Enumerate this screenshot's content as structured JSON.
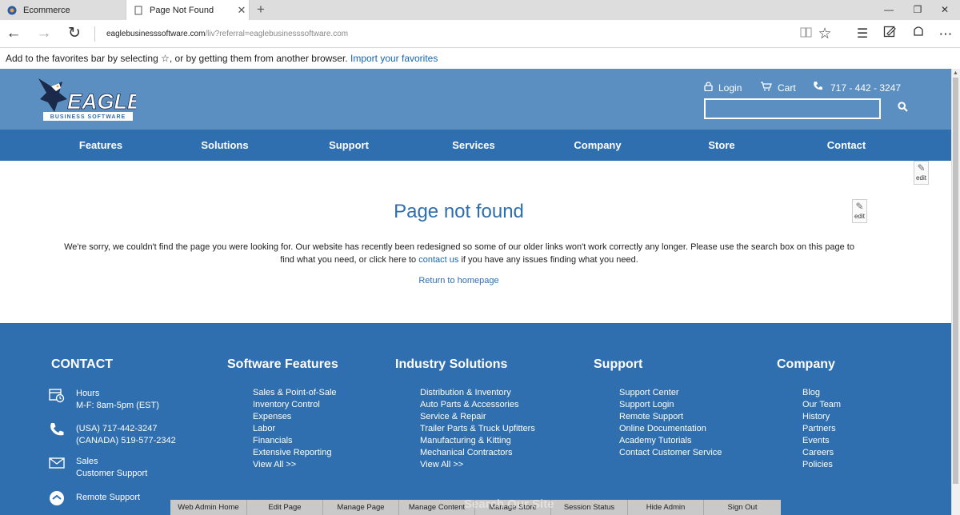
{
  "browser": {
    "tabs": [
      {
        "title": "Ecommerce",
        "active": false
      },
      {
        "title": "Page Not Found",
        "active": true
      }
    ],
    "url": {
      "host": "eaglebusinesssoftware.com",
      "path": "/liv?referral=eaglebusinesssoftware.com"
    },
    "favorites_hint": {
      "text": "Add to the favorites bar by selecting ☆, or by getting them from another browser.",
      "link": "Import your favorites"
    }
  },
  "site": {
    "logo": {
      "word": "EAGLE",
      "tagline": "BUSINESS SOFTWARE"
    },
    "top_links": {
      "login": "Login",
      "cart": "Cart",
      "phone": "717 - 442 - 3247"
    },
    "search": {
      "placeholder": ""
    },
    "nav": [
      "Features",
      "Solutions",
      "Support",
      "Services",
      "Company",
      "Store",
      "Contact"
    ],
    "edit_label": "edit",
    "content": {
      "title": "Page not found",
      "message_before": "We're sorry, we couldn't find the page you were looking for. Our website has recently been redesigned so some of our older links won't work correctly any longer. Please use the search box on this page to find what you need, or click here to",
      "message_link": "contact us",
      "message_after": "if you have any issues finding what you need.",
      "return_link": "Return to homepage"
    },
    "footer": {
      "contact": {
        "heading": "CONTACT",
        "hours": [
          "Hours",
          "M-F: 8am-5pm (EST)"
        ],
        "phones": [
          "(USA) 717-442-3247",
          "(CANADA) 519-577-2342"
        ],
        "sales": [
          "Sales",
          "Customer Support"
        ],
        "remote": "Remote Support"
      },
      "columns": [
        {
          "heading": "Software Features",
          "items": [
            "Sales & Point-of-Sale",
            "Inventory Control",
            "Expenses",
            "Labor",
            "Financials",
            "Extensive Reporting",
            "View All >>"
          ]
        },
        {
          "heading": "Industry Solutions",
          "items": [
            "Distribution & Inventory",
            "Auto Parts & Accessories",
            "Service & Repair",
            "Trailer Parts & Truck Upfitters",
            "Manufacturing & Kitting",
            "Mechanical Contractors",
            "View All >>"
          ]
        },
        {
          "heading": "Support",
          "items": [
            "Support Center",
            "Support Login",
            "Remote Support",
            "Online Documentation",
            "Academy Tutorials",
            "Contact Customer Service"
          ]
        },
        {
          "heading": "Company",
          "items": [
            "Blog",
            "Our Team",
            "History",
            "Partners",
            "Events",
            "Careers",
            "Policies"
          ]
        }
      ]
    },
    "search_overlay": "Search Our Site"
  },
  "admin_bar": [
    "Web Admin Home",
    "Edit Page",
    "Manage Page",
    "Manage Content",
    "Manage Store",
    "Session Status",
    "Hide Admin",
    "Sign Out"
  ],
  "colors": {
    "header": "#5b8ec1",
    "nav": "#2f6eaf",
    "link": "#1565b0"
  }
}
